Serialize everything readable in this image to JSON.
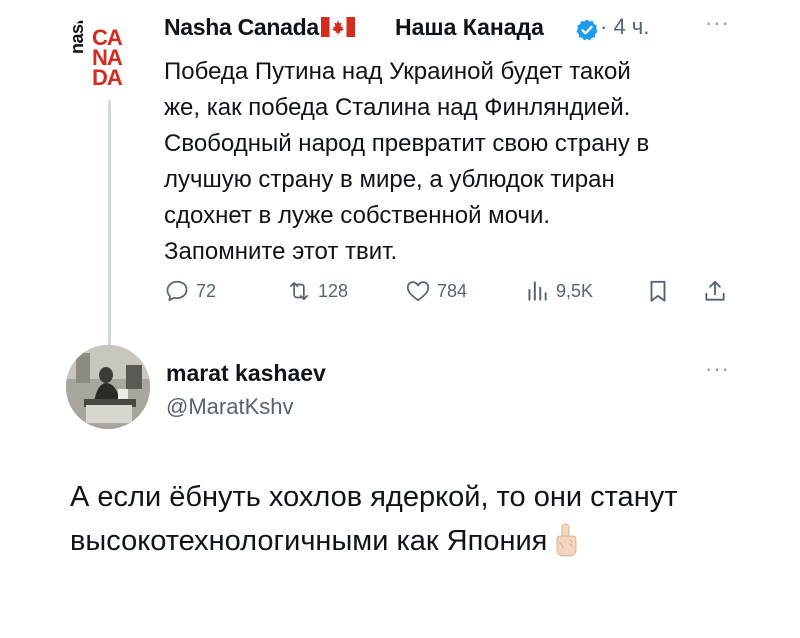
{
  "tweet1": {
    "author_name": "Nasha Canada",
    "author_name_ru": "Наша Канада",
    "logo_text_vertical": "nasha",
    "logo_text_letters": [
      "CA",
      "NA",
      "DA"
    ],
    "time": "· 4 ч.",
    "more": "···",
    "text_lines": [
      "Победа Путина над Украиной будет такой",
      "же, как победа Сталина над Финляндией.",
      "Свободный народ превратит свою страну в",
      "лучшую страну в мире, а ублюдок тиран",
      "сдохнет в луже собственной мочи.",
      "Запомните этот твит."
    ],
    "stats": {
      "replies": "72",
      "retweets": "128",
      "likes": "784",
      "views": "9,5K"
    }
  },
  "tweet2": {
    "author_name": "marat kashaev",
    "handle": "@MaratKshv",
    "more": "···",
    "text_lines": [
      "А если ёбнуть хохлов ядеркой, то они станут",
      "высокотехнологичными как Япония"
    ]
  },
  "colors": {
    "accent_blue": "#1d9bf0",
    "muted_text": "#536471",
    "canada_red": "#d52b1e",
    "thread_line": "#cfd9de"
  }
}
